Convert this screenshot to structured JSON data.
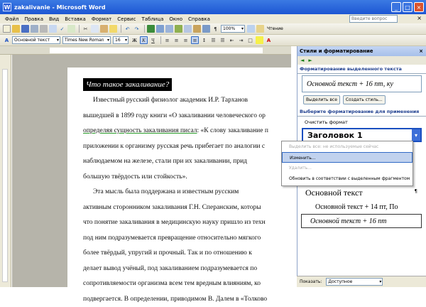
{
  "window": {
    "title": "zakalivanie - Microsoft Word"
  },
  "menu": {
    "items": [
      "Файл",
      "Правка",
      "Вид",
      "Вставка",
      "Формат",
      "Сервис",
      "Таблица",
      "Окно",
      "Справка"
    ],
    "help_placeholder": "Введите вопрос",
    "close_doc": "×"
  },
  "toolbar": {
    "zoom": "100%",
    "read_label": "Чтение",
    "style": "Основной текст",
    "font": "Times New Roman",
    "size": "16"
  },
  "document": {
    "heading": "Что такое закаливание?",
    "lines": [
      {
        "text": "Известный русский физиолог академик И.Р. Тарханов",
        "indent": true
      },
      {
        "text": "вышедшей в 1899 году книги «О закаливании человеческого ор",
        "indent": false
      },
      {
        "text": "определяя сущность закаливания писал: «К слову закаливание п",
        "indent": false,
        "underline": "определяя сущность закаливания писал"
      },
      {
        "text": "приложении к организму русская речь прибегает по аналогии с",
        "indent": false
      },
      {
        "text": "наблюдаемом на железе,  стали при их закаливании,  прид",
        "indent": false
      },
      {
        "text": "большую твёрдость или стойкость».",
        "indent": false
      },
      {
        "text": "Эта мысль была поддержана и известным русским",
        "indent": true
      },
      {
        "text": "активным сторонником закаливания Г.Н. Сперанским,  которы",
        "indent": false
      },
      {
        "text": "что понятие закаливания в медицинскую науку пришло из техн",
        "indent": false
      },
      {
        "text": "под ним подразумевается превращение относительно мягкого",
        "indent": false
      },
      {
        "text": "более твёрдый,  упругий и прочный. Так и по отношению к",
        "indent": false
      },
      {
        "text": "делает вывод учёный,  под закаливанием подразумевается по",
        "indent": false
      },
      {
        "text": "сопротивляемости организма всем тем вредным влияниям,  ко",
        "indent": false
      },
      {
        "text": "подвергается. В определении, приводимом В. Далем в «Толково",
        "indent": false
      }
    ]
  },
  "taskpane": {
    "title": "Стили и форматирование",
    "close": "×",
    "nav_back": "◄",
    "nav_forward": "►",
    "selected_section": "Форматирование выделенного текста",
    "current_style": "Основной текст + 16 пт, ку",
    "btn_select_all": "Выделить все",
    "btn_new_style": "Создать стиль...",
    "apply_section": "Выберите форматирование для применения",
    "clear_format": "Очистить формат",
    "heading_style": "Заголовок 1",
    "style_list": [
      "Основной текст",
      "Основной текст + 14 пт, По",
      "Основной текст + 16 пт"
    ],
    "show_label": "Показать:",
    "show_value": "Доступное"
  },
  "context_menu": {
    "items": [
      "Выделить все: не используемые сейчас",
      "Изменить...",
      "Удалить...",
      "Обновить в соответствии с выделенным фрагментом"
    ]
  }
}
